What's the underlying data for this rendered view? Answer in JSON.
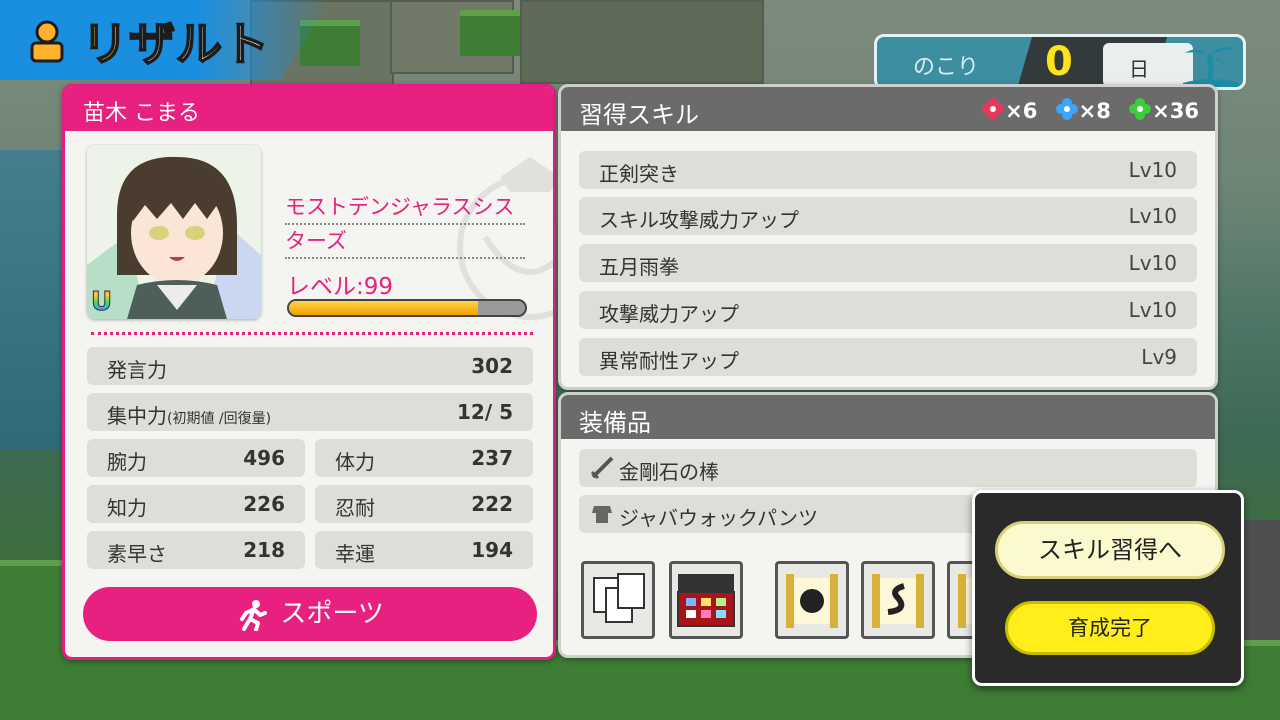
{
  "title": {
    "first": "リ",
    "rest": "ザルト"
  },
  "days_remaining": {
    "label": "のこり",
    "count": "0",
    "unit": "日"
  },
  "character": {
    "name": "苗木 こまる",
    "talent_line1": "モストデンジャラスシス",
    "talent_line2": "ターズ",
    "level_label": "レベル:99",
    "level_progress_fraction": 0.8,
    "rank": "U",
    "stats": {
      "speech": {
        "label": "発言力",
        "value": "302"
      },
      "focus": {
        "label": "集中力",
        "note": "(初期値 /回復量)",
        "value": "12/  5"
      },
      "strength": {
        "label": "腕力",
        "value": "496"
      },
      "stamina": {
        "label": "体力",
        "value": "237"
      },
      "intellect": {
        "label": "知力",
        "value": "226"
      },
      "endurance": {
        "label": "忍耐",
        "value": "222"
      },
      "agility": {
        "label": "素早さ",
        "value": "218"
      },
      "luck": {
        "label": "幸運",
        "value": "194"
      }
    },
    "activity_button": "スポーツ"
  },
  "skills_panel": {
    "title": "習得スキル",
    "gems": [
      {
        "color": "#e8375a",
        "count": "×6"
      },
      {
        "color": "#3aa6ff",
        "count": "×8"
      },
      {
        "color": "#3ccf3c",
        "count": "×36"
      }
    ],
    "skills": [
      {
        "name": "正剣突き",
        "level": "Lv10"
      },
      {
        "name": "スキル攻撃威力アップ",
        "level": "Lv10"
      },
      {
        "name": "五月雨拳",
        "level": "Lv10"
      },
      {
        "name": "攻撃威力アップ",
        "level": "Lv10"
      },
      {
        "name": "異常耐性アップ",
        "level": "Lv9"
      }
    ]
  },
  "equipment_panel": {
    "title": "装備品",
    "items": [
      {
        "name": "金剛石の棒",
        "icon": "sword-icon"
      },
      {
        "name": "ジャバウォックパンツ",
        "icon": "armor-icon"
      }
    ],
    "inventory_icons": [
      "cards-icon",
      "jewel-case-icon",
      "tiger-scroll-icon",
      "snake-scroll-icon",
      "scroll-icon"
    ]
  },
  "dialog": {
    "skill_button": "スキル習得へ",
    "done_button": "育成完了"
  }
}
